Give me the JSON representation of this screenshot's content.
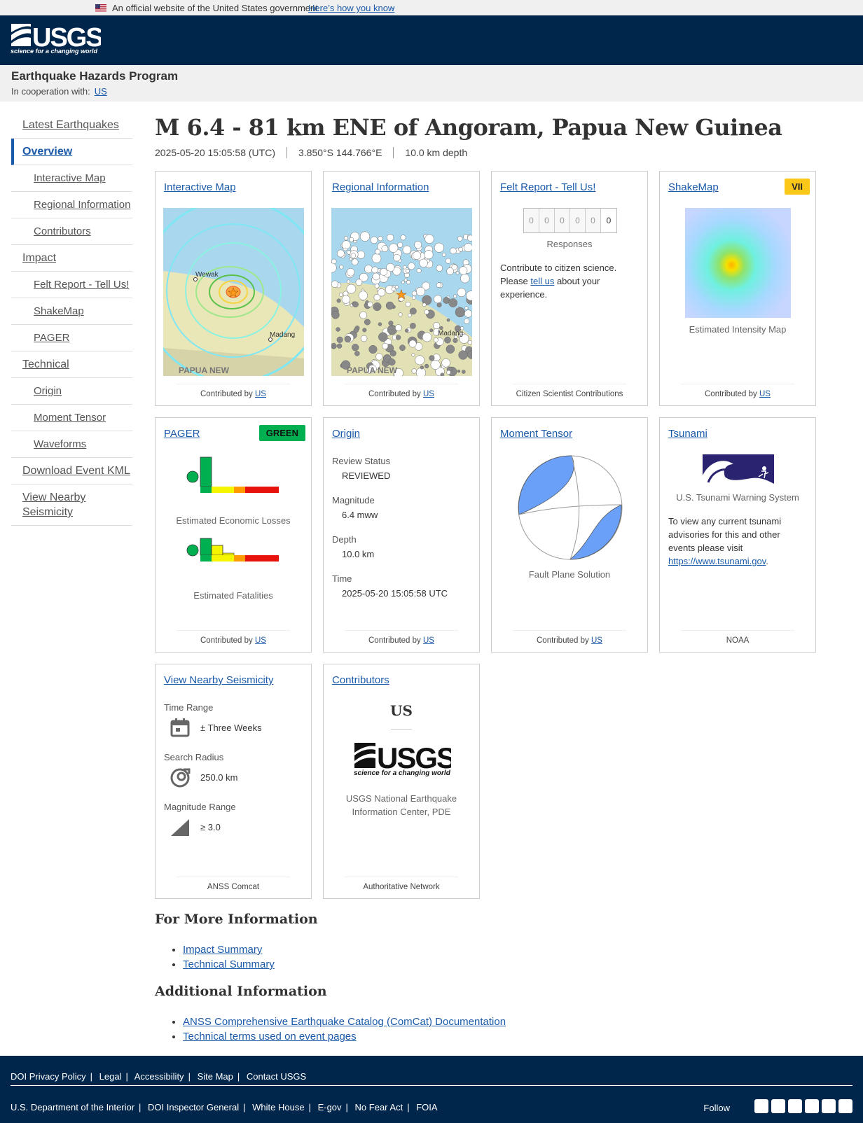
{
  "gov_banner": {
    "text": "An official website of the United States government",
    "link": "Here’s how you know"
  },
  "header": {
    "logo_text": "USGS",
    "logo_tagline": "science for a changing world"
  },
  "program": {
    "title": "Earthquake Hazards Program",
    "coop_label": "In cooperation with:",
    "coop_link": "US"
  },
  "nav": [
    {
      "label": "Latest Earthquakes"
    },
    {
      "label": "Overview"
    },
    {
      "label": "Interactive Map"
    },
    {
      "label": "Regional Information"
    },
    {
      "label": "Contributors"
    },
    {
      "label": "Impact"
    },
    {
      "label": "Felt Report - Tell Us!"
    },
    {
      "label": "ShakeMap"
    },
    {
      "label": "PAGER"
    },
    {
      "label": "Technical"
    },
    {
      "label": "Origin"
    },
    {
      "label": "Moment Tensor"
    },
    {
      "label": "Waveforms"
    },
    {
      "label": "Download Event KML"
    },
    {
      "label": "View Nearby Seismicity"
    }
  ],
  "event": {
    "title": "M 6.4 - 81 km ENE of Angoram, Papua New Guinea",
    "time": "2025-05-20 15:05:58 (UTC)",
    "location": "3.850°S 144.766°E",
    "depth": "10.0 km depth"
  },
  "cards": {
    "interactive_map": {
      "title": "Interactive Map",
      "contributed": "Contributed by",
      "by": "US",
      "map_labels": [
        "Wewak",
        "Madang",
        "PAPUA NEW"
      ]
    },
    "regional": {
      "title": "Regional Information",
      "contributed": "Contributed by",
      "by": "US",
      "map_labels": [
        "Madang",
        "PAPUA NEW"
      ]
    },
    "felt": {
      "title": "Felt Report - Tell Us!",
      "digits": [
        "0",
        "0",
        "0",
        "0",
        "0",
        "0"
      ],
      "responses": "Responses",
      "text1": "Contribute to citizen science. Please ",
      "link": "tell us",
      "text2": " about your experience.",
      "footer": "Citizen Scientist Contributions"
    },
    "shakemap": {
      "title": "ShakeMap",
      "badge": "VII",
      "badge_color": "#fbc81a",
      "caption": "Estimated Intensity Map",
      "contributed": "Contributed by",
      "by": "US"
    },
    "pager": {
      "title": "PAGER",
      "badge": "GREEN",
      "badge_color": "#00b050",
      "losses": "Estimated Economic Losses",
      "fatalities": "Estimated Fatalities",
      "contributed": "Contributed by",
      "by": "US"
    },
    "origin": {
      "title": "Origin",
      "fields": [
        {
          "label": "Review Status",
          "value": "REVIEWED"
        },
        {
          "label": "Magnitude",
          "value": "6.4 mww"
        },
        {
          "label": "Depth",
          "value": "10.0 km"
        },
        {
          "label": "Time",
          "value": "2025-05-20 15:05:58 UTC"
        }
      ],
      "contributed": "Contributed by",
      "by": "US"
    },
    "moment_tensor": {
      "title": "Moment Tensor",
      "caption": "Fault Plane Solution",
      "contributed": "Contributed by",
      "by": "US"
    },
    "tsunami": {
      "title": "Tsunami",
      "caption": "U.S. Tsunami Warning System",
      "text": "To view any current tsunami advisories for this and other events please visit ",
      "link": "https://www.tsunami.gov",
      "footer": "NOAA"
    },
    "nearby": {
      "title": "View Nearby Seismicity",
      "time_label": "Time Range",
      "time_value": "± Three Weeks",
      "radius_label": "Search Radius",
      "radius_value": "250.0 km",
      "mag_label": "Magnitude Range",
      "mag_value": "≥ 3.0",
      "footer": "ANSS Comcat"
    },
    "contributors": {
      "title": "Contributors",
      "network": "US",
      "name": "USGS National Earthquake Information Center, PDE",
      "footer": "Authoritative Network"
    }
  },
  "more_info": {
    "heading": "For More Information",
    "links": [
      "Impact Summary",
      "Technical Summary"
    ]
  },
  "additional": {
    "heading": "Additional Information",
    "links": [
      "ANSS Comprehensive Earthquake Catalog (ComCat) Documentation",
      "Technical terms used on event pages"
    ]
  },
  "footer": {
    "row1": [
      "DOI Privacy Policy",
      "Legal",
      "Accessibility",
      "Site Map",
      "Contact USGS"
    ],
    "row2": [
      "U.S. Department of the Interior",
      "DOI Inspector General",
      "White House",
      "E-gov",
      "No Fear Act",
      "FOIA"
    ],
    "follow": "Follow",
    "social_icons": [
      "twitter-icon",
      "facebook-icon",
      "github-icon",
      "flickr-icon",
      "youtube-icon",
      "instagram-icon"
    ]
  }
}
